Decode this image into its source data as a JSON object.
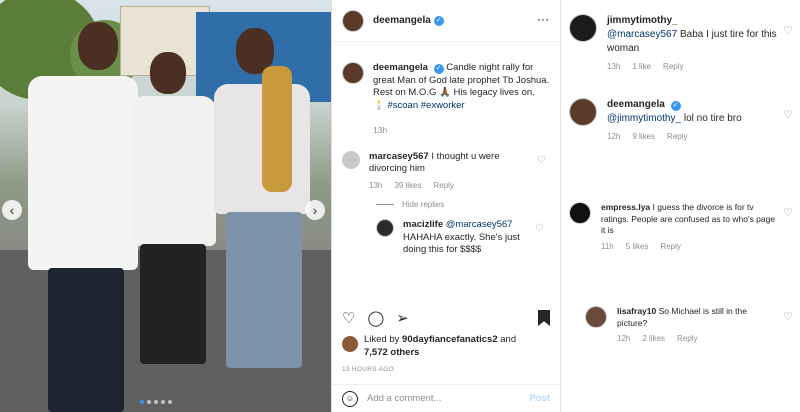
{
  "post": {
    "username": "deemangela",
    "caption_lines": [
      "Candle night rally for",
      "great Man of God late prophet Tb",
      "Joshua.",
      "Rest on M.O.G 🙏🏾 His legacy lives on.",
      "🕯️"
    ],
    "hashtags": "#scoan #exworker",
    "time": "13h",
    "liked_by_prefix": "Liked by ",
    "liked_by_user": "90dayfiancefanatics2",
    "liked_by_mid": " and",
    "liked_by_count": "7,572 others",
    "posted_ago": "13 HOURS AGO",
    "add_comment_placeholder": "Add a comment...",
    "post_label": "Post"
  },
  "comments": [
    {
      "user": "marcasey567",
      "text": "I thought u were divorcing him",
      "time": "13h",
      "likes": "39 likes",
      "reply": "Reply"
    },
    {
      "user": "macizlife",
      "mention": "@marcasey567",
      "text": "HAHAHA exactly. She's just doing this for $$$$"
    }
  ],
  "hide_replies": "Hide replies",
  "right_comments": [
    {
      "user": "jimmytimothy_",
      "mention": "@marcasey567",
      "text": "Baba I just tire for this woman",
      "time": "13h",
      "likes": "1 like",
      "reply": "Reply"
    },
    {
      "user": "deemangela",
      "mention": "@jimmytimothy_",
      "text": "lol no tire bro",
      "time": "12h",
      "likes": "9 likes",
      "reply": "Reply"
    },
    {
      "user": "empress.lya",
      "text": "I guess the divorce is for tv ratings. People are confused as to who's page it is",
      "time": "11h",
      "likes": "5 likes",
      "reply": "Reply"
    },
    {
      "user": "lisafray10",
      "text": "So Michael is still in the picture?",
      "time": "12h",
      "likes": "2 likes",
      "reply": "Reply"
    }
  ],
  "icons": {
    "heart": "heart-icon",
    "comment": "comment-icon",
    "share": "share-icon",
    "bookmark": "bookmark-icon",
    "emoji": "emoji-icon"
  },
  "colors": {
    "verified": "#3897f0",
    "link": "#00376b",
    "meta": "#8e8e8e",
    "post_button": "#b3dbff"
  }
}
